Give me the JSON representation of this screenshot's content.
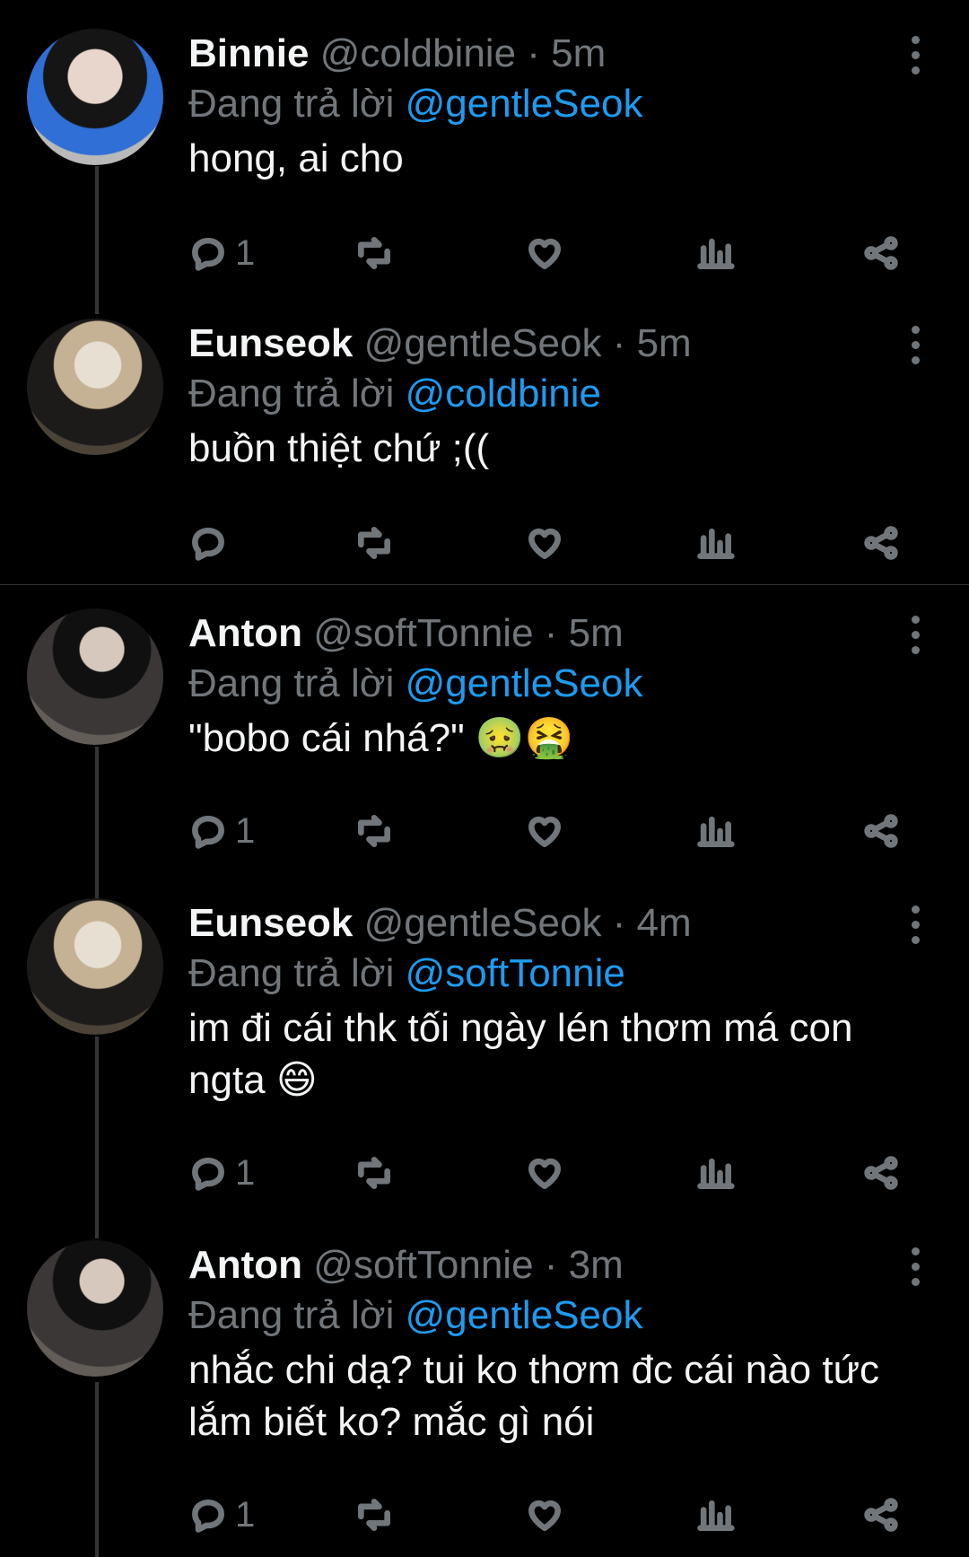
{
  "reply_prefix": "Đang trả lời",
  "tweets": [
    {
      "name": "Binnie",
      "handle": "@coldbinie",
      "time": "· 5m",
      "reply_to": "@gentleSeok",
      "text": "hong, ai cho",
      "reply_count": "1"
    },
    {
      "name": "Eunseok",
      "handle": "@gentleSeok",
      "time": "· 5m",
      "reply_to": "@coldbinie",
      "text": "buồn thiệt chứ ;((",
      "reply_count": ""
    },
    {
      "name": "Anton",
      "handle": "@softTonnie",
      "time": "· 5m",
      "reply_to": "@gentleSeok",
      "text": "\"bobo cái nhá?\" 🤢🤮",
      "reply_count": "1"
    },
    {
      "name": "Eunseok",
      "handle": "@gentleSeok",
      "time": "· 4m",
      "reply_to": "@softTonnie",
      "text": "im đi cái thk tối ngày lén thơm má con ngta 😄",
      "reply_count": "1"
    },
    {
      "name": "Anton",
      "handle": "@softTonnie",
      "time": "· 3m",
      "reply_to": "@gentleSeok",
      "text": "nhắc chi dạ? tui ko thơm đc cái nào tức lắm biết ko? mắc gì nói",
      "reply_count": "1"
    }
  ]
}
